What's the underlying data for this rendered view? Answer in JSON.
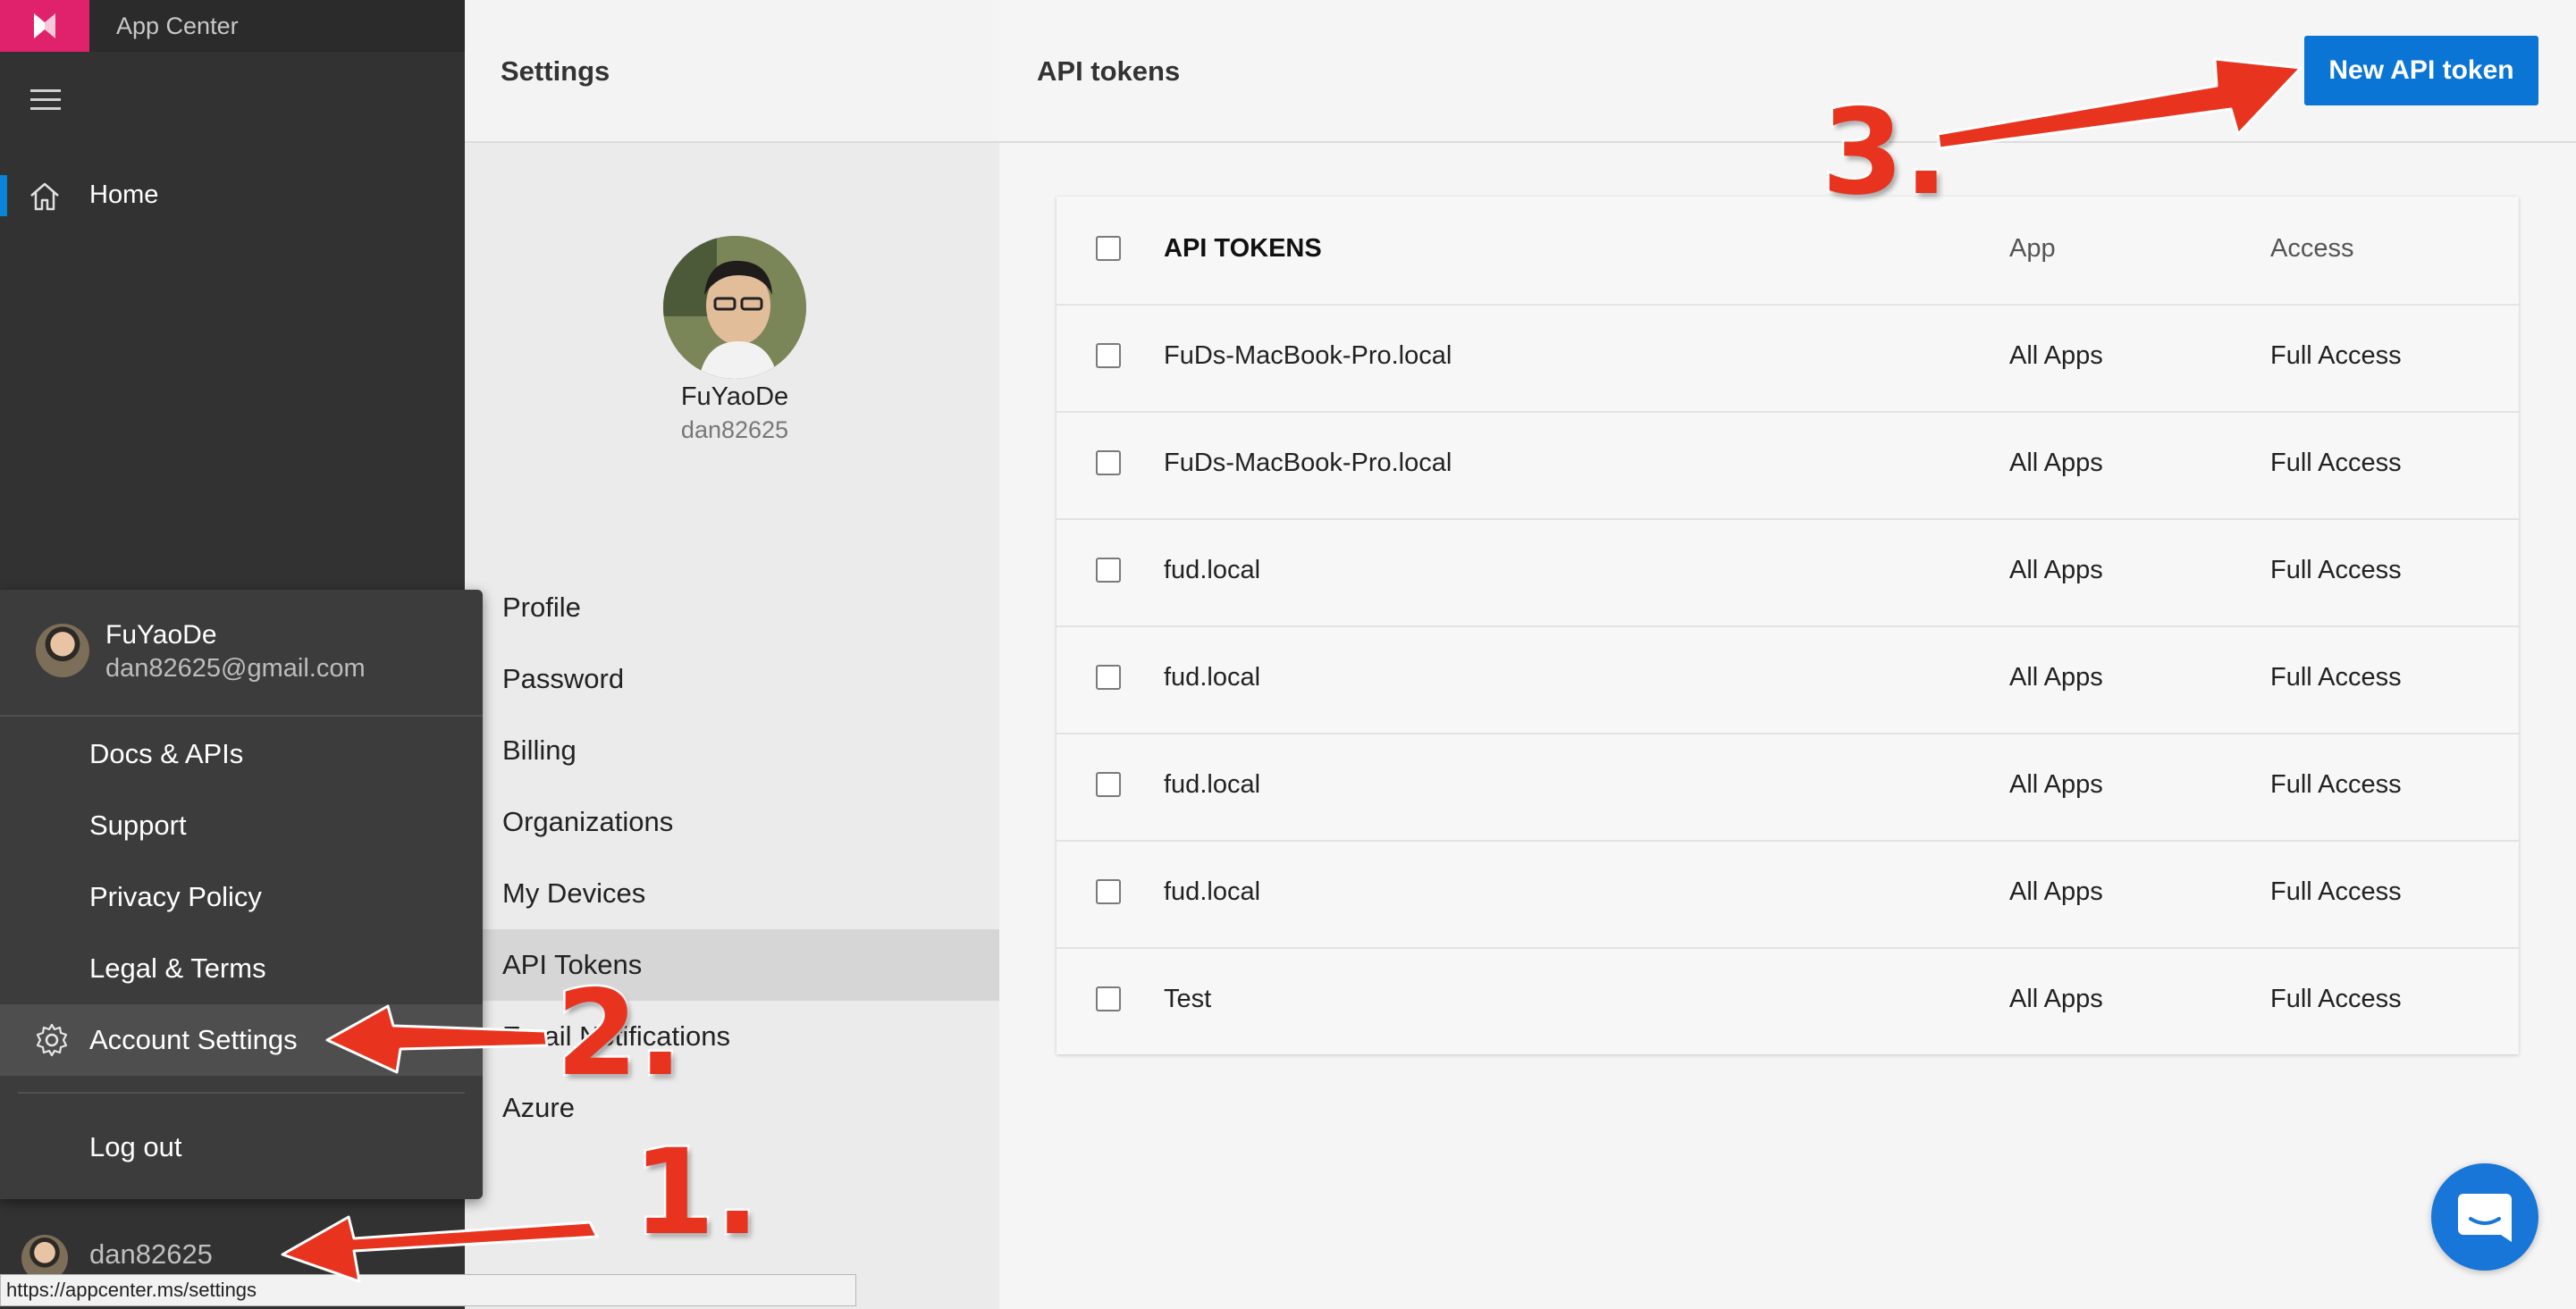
{
  "nav": {
    "app_title": "App Center",
    "home_label": "Home",
    "username": "dan82625"
  },
  "account_menu": {
    "name": "FuYaoDe",
    "email": "dan82625@gmail.com",
    "items": [
      "Docs & APIs",
      "Support",
      "Privacy Policy",
      "Legal & Terms",
      "Account Settings",
      "Log out"
    ]
  },
  "settings": {
    "title": "Settings",
    "profile_name": "FuYaoDe",
    "profile_handle": "dan82625",
    "items": [
      "Profile",
      "Password",
      "Billing",
      "Organizations",
      "My Devices",
      "API Tokens",
      "Email Notifications",
      "Azure"
    ],
    "active_item": "API Tokens"
  },
  "main": {
    "title": "API tokens",
    "new_token_label": "New API token",
    "table": {
      "headers": [
        "API TOKENS",
        "App",
        "Access"
      ],
      "rows": [
        {
          "name": "FuDs-MacBook-Pro.local",
          "app": "All Apps",
          "access": "Full Access"
        },
        {
          "name": "FuDs-MacBook-Pro.local",
          "app": "All Apps",
          "access": "Full Access"
        },
        {
          "name": "fud.local",
          "app": "All Apps",
          "access": "Full Access"
        },
        {
          "name": "fud.local",
          "app": "All Apps",
          "access": "Full Access"
        },
        {
          "name": "fud.local",
          "app": "All Apps",
          "access": "Full Access"
        },
        {
          "name": "fud.local",
          "app": "All Apps",
          "access": "Full Access"
        },
        {
          "name": "Test",
          "app": "All Apps",
          "access": "Full Access"
        }
      ]
    }
  },
  "status_url": "https://appcenter.ms/settings",
  "annotations": {
    "step1": "1.",
    "step2": "2.",
    "step3": "3."
  },
  "colors": {
    "brand": "#e0216b",
    "accent": "#0a75d4",
    "annotation": "#e8331f"
  }
}
